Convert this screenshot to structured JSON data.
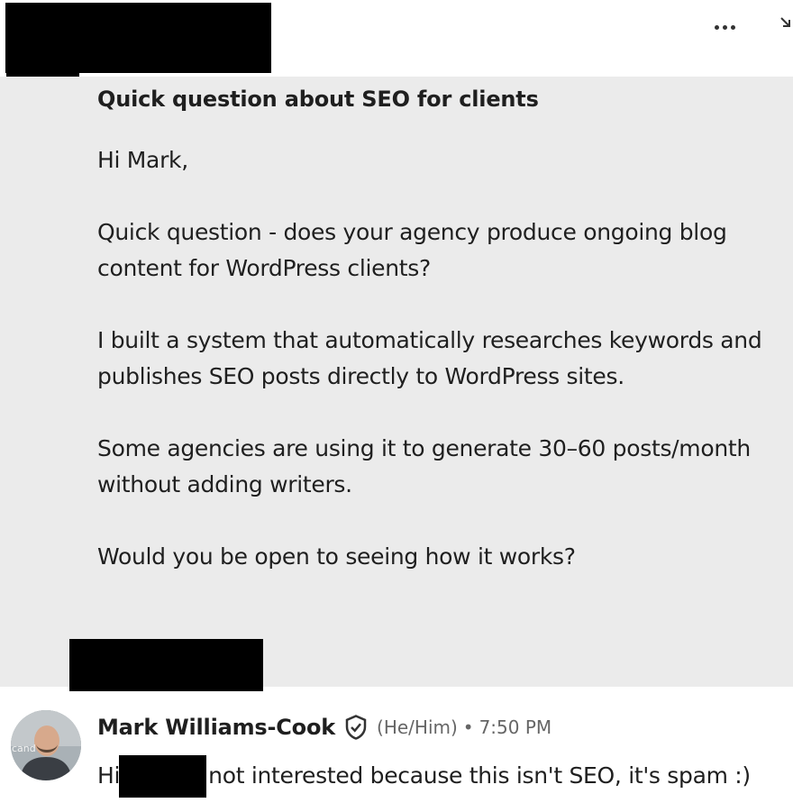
{
  "message": {
    "subject": "Quick question about SEO for clients",
    "greeting": "Hi Mark,",
    "paragraph_1": "Quick question - does your agency produce ongoing blog content for WordPress clients?",
    "paragraph_2": "I built a system that automatically researches keywords and publishes SEO posts directly to WordPress sites.",
    "paragraph_3": "Some agencies are using it to generate 30–60 posts/month without adding writers.",
    "paragraph_4": "Would you be open to seeing how it works?"
  },
  "reply": {
    "name": "Mark Williams-Cook",
    "pronouns": "(He/Him)",
    "separator": "•",
    "time": "7:50 PM",
    "text_start": "Hi",
    "text_end": "not interested because this isn't SEO, it's spam :)",
    "avatar_text": "cand"
  },
  "icons": {
    "more": "more-options-icon",
    "expand": "expand-arrow-icon",
    "verified": "verified-shield-icon"
  },
  "colors": {
    "message_background": "#ebebeb",
    "page_background": "#ffffff",
    "text": "#1f1f1f",
    "meta_text": "#666666",
    "redaction": "#000000"
  }
}
